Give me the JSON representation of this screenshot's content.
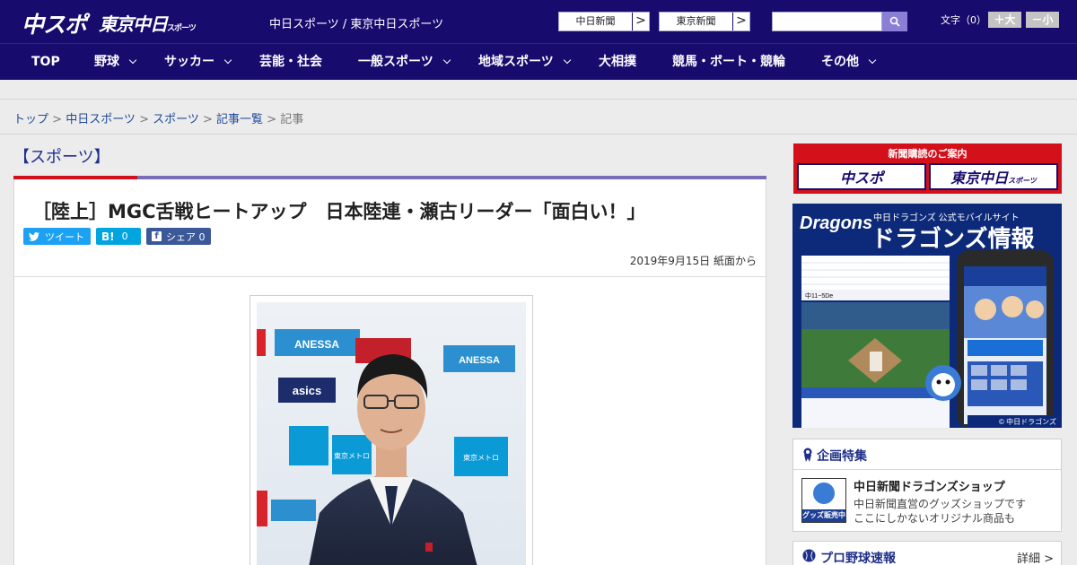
{
  "header": {
    "logo_chuspo": "中スポ",
    "logo_tokyo": "東京中日",
    "logo_tokyo_sub": "スポーツ",
    "site_names": "中日スポーツ / 東京中日スポーツ",
    "btn_chunichi": "中日新聞",
    "btn_tokyo": "東京新聞",
    "arrow": ">",
    "search_placeholder": "",
    "font_size_label": "文字（0）",
    "font_bigger": "＋大",
    "font_smaller": "－小"
  },
  "nav": {
    "items": [
      {
        "label": "TOP"
      },
      {
        "label": "野球"
      },
      {
        "label": "サッカー"
      },
      {
        "label": "芸能・社会"
      },
      {
        "label": "一般スポーツ"
      },
      {
        "label": "地域スポーツ"
      },
      {
        "label": "大相撲"
      },
      {
        "label": "競馬・ボート・競輪"
      },
      {
        "label": "その他"
      }
    ]
  },
  "breadcrumb": {
    "items": [
      "トップ",
      "中日スポーツ",
      "スポーツ",
      "記事一覧"
    ],
    "current": "記事",
    "sep": " > "
  },
  "article": {
    "section": "【スポーツ】",
    "title": "［陸上］MGC舌戦ヒートアップ　日本陸連・瀬古リーダー「面白い！」",
    "share_tweet": "ツイート",
    "share_hatena_icon": "B!",
    "share_hatena_count": "0",
    "share_fb": "シェア 0",
    "date": "2019年9月15日 紙面から",
    "photo_sponsors": [
      "ANESSA",
      "asics",
      "ANESSA",
      "東京メトロ",
      "東京メトロ"
    ]
  },
  "sidebar": {
    "promo_title": "新聞購読のご案内",
    "promo_left": "中スポ",
    "promo_right": "東京中日",
    "promo_right_sub": "スポーツ",
    "dragons_logo": "Dragons",
    "dragons_small": "中日ドラゴンズ 公式モバイルサイト",
    "dragons_big": "ドラゴンズ情報",
    "dragons_score": "中11−5De",
    "dragons_copyright": "© 中日ドラゴンズ",
    "feature_title": "企画特集",
    "feature_item_title": "中日新聞ドラゴンズショップ",
    "feature_item_line1": "中日新聞直営のグッズショップです",
    "feature_item_line2": "ここにしかないオリジナル商品も",
    "feature_badge": "グッズ販売中",
    "baseball_title": "プロ野球速報",
    "baseball_more": "詳細 >"
  },
  "colors": {
    "header_bg": "#170b6e",
    "accent_red": "#d0101c",
    "accent_purple": "#7a6db8",
    "twitter": "#1da1f2",
    "hatena": "#00a4de",
    "facebook": "#3b5998"
  }
}
